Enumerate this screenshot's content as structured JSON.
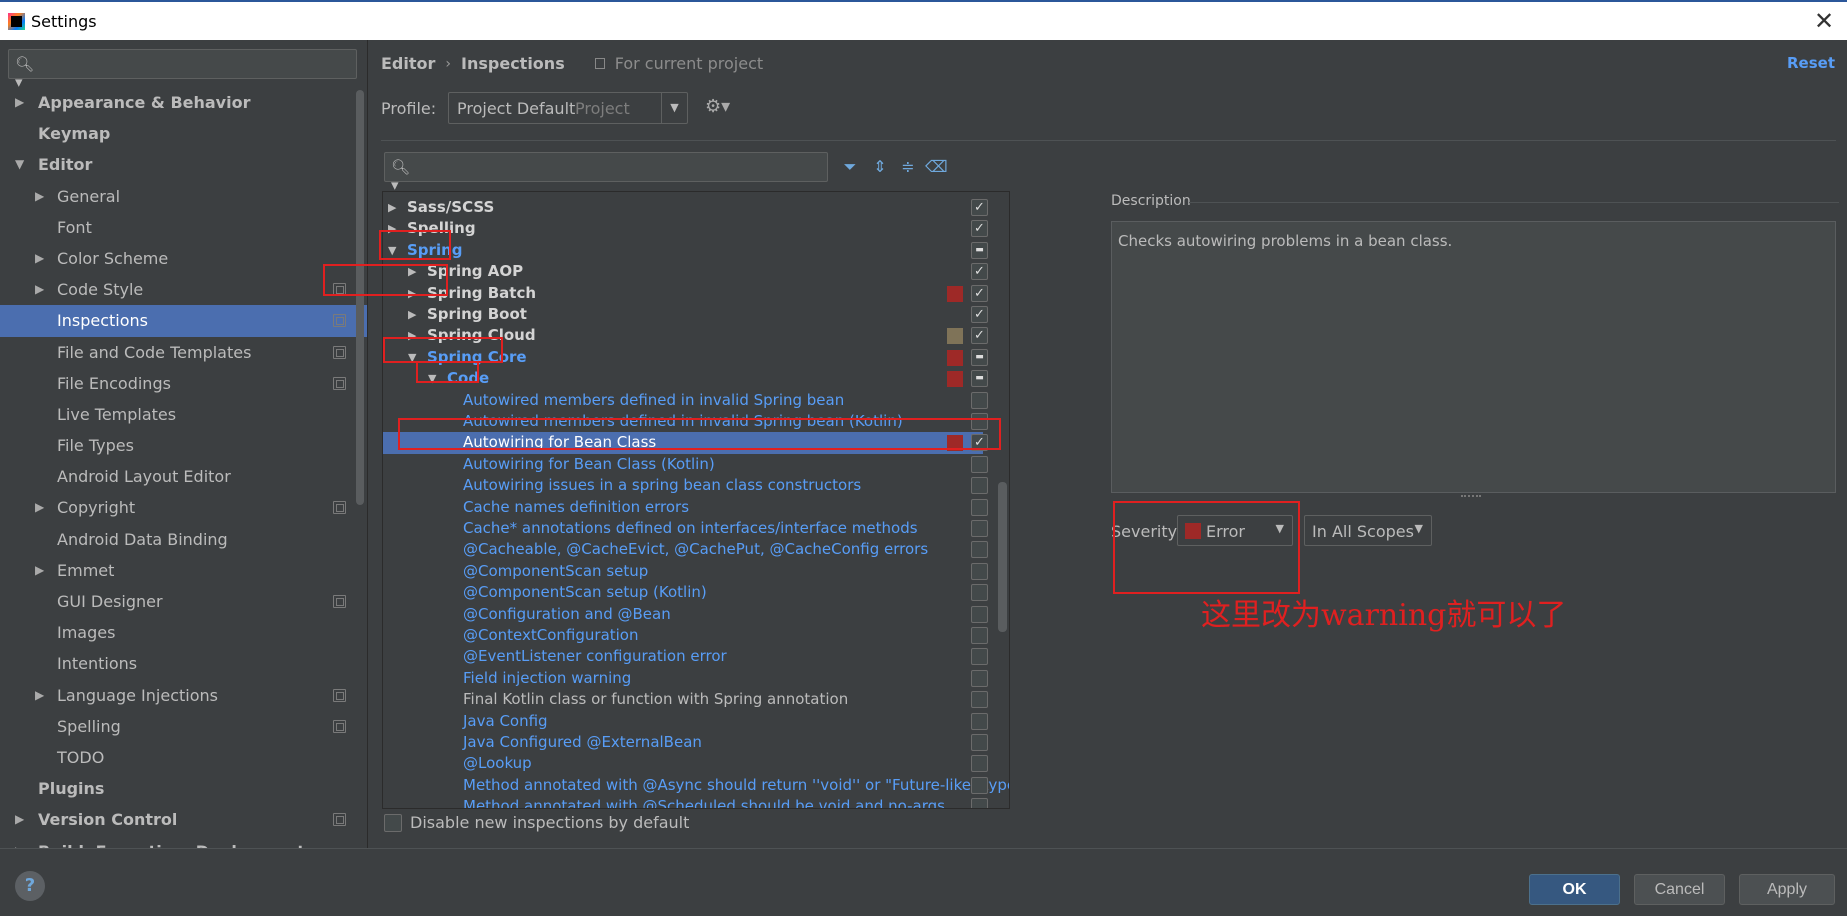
{
  "window": {
    "title": "Settings"
  },
  "sidebar": {
    "items": [
      {
        "label": "Appearance & Behavior",
        "bold": true,
        "indent": 0,
        "arrow": "right"
      },
      {
        "label": "Keymap",
        "bold": true,
        "indent": 0,
        "arrow": ""
      },
      {
        "label": "Editor",
        "bold": true,
        "indent": 0,
        "arrow": "down"
      },
      {
        "label": "General",
        "indent": 1,
        "arrow": "right"
      },
      {
        "label": "Font",
        "indent": 1,
        "arrow": ""
      },
      {
        "label": "Color Scheme",
        "indent": 1,
        "arrow": "right"
      },
      {
        "label": "Code Style",
        "indent": 1,
        "arrow": "right",
        "copy": true
      },
      {
        "label": "Inspections",
        "indent": 1,
        "arrow": "",
        "copy": true,
        "selected": true
      },
      {
        "label": "File and Code Templates",
        "indent": 1,
        "arrow": "",
        "copy": true
      },
      {
        "label": "File Encodings",
        "indent": 1,
        "arrow": "",
        "copy": true
      },
      {
        "label": "Live Templates",
        "indent": 1,
        "arrow": ""
      },
      {
        "label": "File Types",
        "indent": 1,
        "arrow": ""
      },
      {
        "label": "Android Layout Editor",
        "indent": 1,
        "arrow": ""
      },
      {
        "label": "Copyright",
        "indent": 1,
        "arrow": "right",
        "copy": true
      },
      {
        "label": "Android Data Binding",
        "indent": 1,
        "arrow": ""
      },
      {
        "label": "Emmet",
        "indent": 1,
        "arrow": "right"
      },
      {
        "label": "GUI Designer",
        "indent": 1,
        "arrow": "",
        "copy": true
      },
      {
        "label": "Images",
        "indent": 1,
        "arrow": ""
      },
      {
        "label": "Intentions",
        "indent": 1,
        "arrow": ""
      },
      {
        "label": "Language Injections",
        "indent": 1,
        "arrow": "right",
        "copy": true
      },
      {
        "label": "Spelling",
        "indent": 1,
        "arrow": "",
        "copy": true
      },
      {
        "label": "TODO",
        "indent": 1,
        "arrow": ""
      },
      {
        "label": "Plugins",
        "bold": true,
        "indent": 0,
        "arrow": ""
      },
      {
        "label": "Version Control",
        "bold": true,
        "indent": 0,
        "arrow": "right",
        "copy": true
      },
      {
        "label": "Build, Execution, Deployment",
        "bold": true,
        "indent": 0,
        "arrow": "right"
      }
    ]
  },
  "breadcrumb": {
    "parts": [
      "Editor",
      "Inspections"
    ],
    "separator": "›",
    "scope": "For current project"
  },
  "reset_label": "Reset",
  "profile": {
    "label": "Profile:",
    "value": "Project Default",
    "type": "Project"
  },
  "tree": {
    "rows": [
      {
        "label": "Sass/SCSS",
        "level": 0,
        "kind": "group",
        "arrow": "right",
        "check": "on"
      },
      {
        "label": "Spelling",
        "level": 0,
        "kind": "group",
        "arrow": "right",
        "check": "on"
      },
      {
        "label": "Spring",
        "level": 0,
        "kind": "group-hl",
        "arrow": "down",
        "check": "partial"
      },
      {
        "label": "Spring AOP",
        "level": 1,
        "kind": "group",
        "arrow": "right",
        "check": "on"
      },
      {
        "label": "Spring Batch",
        "level": 1,
        "kind": "group",
        "arrow": "right",
        "check": "on",
        "severity": "#9e2927"
      },
      {
        "label": "Spring Boot",
        "level": 1,
        "kind": "group",
        "arrow": "right",
        "check": "on"
      },
      {
        "label": "Spring Cloud",
        "level": 1,
        "kind": "group",
        "arrow": "right",
        "check": "on",
        "severity": "#7f7358"
      },
      {
        "label": "Spring Core",
        "level": 1,
        "kind": "group-hl",
        "arrow": "down",
        "check": "partial",
        "severity": "#9e2927"
      },
      {
        "label": "Code",
        "level": 2,
        "kind": "group-hl",
        "arrow": "down",
        "check": "partial",
        "severity": "#9e2927"
      },
      {
        "label": "Autowired members defined in invalid Spring bean",
        "level": 3,
        "kind": "link",
        "check": "off"
      },
      {
        "label": "Autowired members defined in invalid Spring bean (Kotlin)",
        "level": 3,
        "kind": "link",
        "check": "off"
      },
      {
        "label": "Autowiring for Bean Class",
        "level": 3,
        "kind": "link",
        "check": "on",
        "severity": "#9e2927",
        "selected": true
      },
      {
        "label": "Autowiring for Bean Class (Kotlin)",
        "level": 3,
        "kind": "link",
        "check": "off"
      },
      {
        "label": "Autowiring issues in a spring bean class constructors",
        "level": 3,
        "kind": "link",
        "check": "off"
      },
      {
        "label": "Cache names definition errors",
        "level": 3,
        "kind": "link",
        "check": "off"
      },
      {
        "label": "Cache* annotations defined on interfaces/interface methods",
        "level": 3,
        "kind": "link",
        "check": "off"
      },
      {
        "label": "@Cacheable, @CacheEvict, @CachePut, @CacheConfig errors",
        "level": 3,
        "kind": "link",
        "check": "off"
      },
      {
        "label": "@ComponentScan setup",
        "level": 3,
        "kind": "link",
        "check": "off"
      },
      {
        "label": "@ComponentScan setup (Kotlin)",
        "level": 3,
        "kind": "link",
        "check": "off"
      },
      {
        "label": "@Configuration and @Bean",
        "level": 3,
        "kind": "link",
        "check": "off"
      },
      {
        "label": "@ContextConfiguration",
        "level": 3,
        "kind": "link",
        "check": "off"
      },
      {
        "label": "@EventListener configuration error",
        "level": 3,
        "kind": "link",
        "check": "off"
      },
      {
        "label": "Field injection warning",
        "level": 3,
        "kind": "link",
        "check": "off"
      },
      {
        "label": "Final Kotlin class or function with Spring annotation",
        "level": 3,
        "kind": "plain",
        "check": "off"
      },
      {
        "label": "Java Config",
        "level": 3,
        "kind": "link",
        "check": "off"
      },
      {
        "label": "Java Configured @ExternalBean",
        "level": 3,
        "kind": "link",
        "check": "off"
      },
      {
        "label": "@Lookup",
        "level": 3,
        "kind": "link",
        "check": "off"
      },
      {
        "label": "Method annotated with @Async should return ''void'' or \"Future-like\" type",
        "level": 3,
        "kind": "link",
        "check": "off"
      },
      {
        "label": "Method annotated with @Scheduled should be void and no-args",
        "level": 3,
        "kind": "link",
        "check": "off"
      }
    ]
  },
  "disable_new_label": "Disable new inspections by default",
  "description": {
    "label": "Description",
    "text": "Checks autowiring problems in a bean class."
  },
  "severity": {
    "label": "Severity:",
    "value": "Error",
    "color": "#9e2927"
  },
  "scope_value": "In All Scopes",
  "annotation": "这里改为warning就可以了",
  "footer": {
    "ok": "OK",
    "cancel": "Cancel",
    "apply": "Apply",
    "help": "?"
  }
}
